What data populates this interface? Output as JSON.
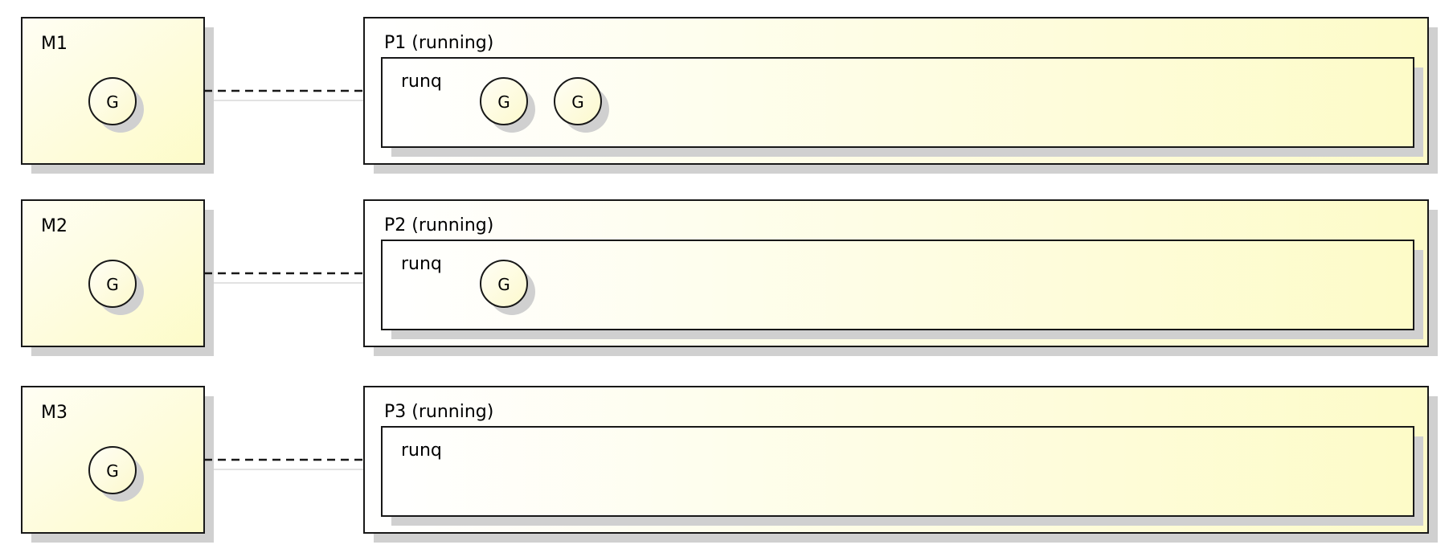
{
  "colors": {
    "fill_light": "#fffef4",
    "fill_yellow": "#fdfbc8",
    "border": "#181818",
    "shadow": "#d0d0d0"
  },
  "rows": [
    {
      "machine": {
        "label": "M1",
        "running_goroutine": "G"
      },
      "processor": {
        "label": "P1 (running)",
        "runq_label": "runq",
        "runq": [
          "G",
          "G"
        ]
      }
    },
    {
      "machine": {
        "label": "M2",
        "running_goroutine": "G"
      },
      "processor": {
        "label": "P2 (running)",
        "runq_label": "runq",
        "runq": [
          "G"
        ]
      }
    },
    {
      "machine": {
        "label": "M3",
        "running_goroutine": "G"
      },
      "processor": {
        "label": "P3 (running)",
        "runq_label": "runq",
        "runq": []
      }
    }
  ]
}
